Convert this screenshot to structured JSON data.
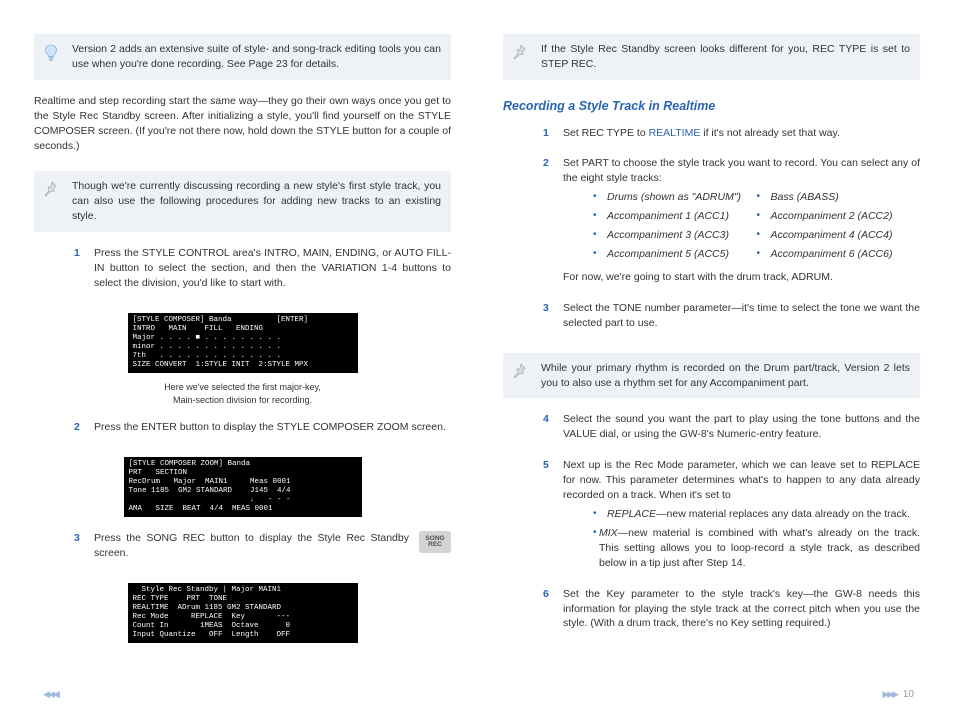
{
  "left": {
    "tip1": "Version 2 adds an extensive suite of style- and song-track editing tools you can use when you're done recording. See Page 23 for details.",
    "intro": "Realtime and step recording start the same way—they go their own ways once you get to the Style Rec Standby screen. After initializing a style, you'll find yourself on the STYLE COMPOSER screen. (If you're not there now, hold down the STYLE button for a couple of seconds.)",
    "tip2": "Though we're currently discussing recording a new style's first style track, you can also use the following procedures for adding new tracks to an existing style.",
    "step1": "Press the STYLE CONTROL area's INTRO, MAIN, ENDING, or AUTO FILL-IN button to select the section, and then the VARIATION 1-4 buttons to select the division, you'd like to start with.",
    "lcd1": "[STYLE COMPOSER] Banda          [ENTER]\nINTRO   MAIN    FILL   ENDING\nMajor . . . . ■ . . . . . . . . .\nminor . . . . . . . . . . . . . .\n7th   . . . . . . . . . . . . . .\nSIZE CONVERT  1:STYLE INIT  2:STYLE MPX",
    "caption1a": "Here we've selected the first major-key,",
    "caption1b": "Main-section division for recording.",
    "step2": "Press the ENTER button to display the STYLE COMPOSER ZOOM screen.",
    "lcd2": "[STYLE COMPOSER ZOOM] Banda\nPRT   SECTION\nRecDrum   Major  MAIN1     Meas 0001\nTone 1185  GM2 STANDARD    J145  4/4\n                           ♩   - - -\nAMA   SIZE  BEAT  4/4  MEAS 0001",
    "step3": "Press the SONG REC button to display the Style Rec Standby screen.",
    "songrec": "SONG\nREC",
    "lcd3": "  Style Rec Standby | Major MAIN1\nREC TYPE    PRT  TONE\nREALTIME  ADrum 1185 GM2 STANDARD\nRec Mode     REPLACE  Key       ---\nCount In       1MEAS  Octave      0\nInput Quantize   OFF  Length    OFF"
  },
  "right": {
    "tip1": "If the Style Rec Standby screen looks different for you, REC TYPE is set to STEP REC.",
    "heading": "Recording a Style Track in Realtime",
    "step1a": "Set REC TYPE to ",
    "step1link": "REALTIME",
    "step1b": " if it's not already set that way.",
    "step2": "Set PART to choose the style track you want to record. You can select any of the eight style tracks:",
    "bcolA": [
      "Drums (shown as \"ADRUM\")",
      "Accompaniment 1 (ACC1)",
      "Accompaniment 3 (ACC3)",
      "Accompaniment 5 (ACC5)"
    ],
    "bcolB": [
      "Bass (ABASS)",
      "Accompaniment 2 (ACC2)",
      "Accompaniment 4 (ACC4)",
      "Accompaniment 6 (ACC6)"
    ],
    "step2after": "For now, we're going to start with the drum track, ADRUM.",
    "step3": "Select the TONE number parameter—it's time to select the tone we want the selected part to use.",
    "tip2": "While your primary rhythm is recorded on the Drum part/track, Version 2 lets you to also use a rhythm set for any Accompaniment part.",
    "step4": "Select the sound you want the part to play using the tone buttons and the VALUE dial, or using the GW-8's Numeric-entry feature.",
    "step5": "Next up is the Rec Mode parameter, which we can leave set to REPLACE for now. This parameter determines what's to happen to any data already recorded on a track. When it's set to",
    "sub5": [
      {
        "term": "REPLACE",
        "rest": "—new material replaces any data already on the track."
      },
      {
        "term": "MIX",
        "rest": "—new material is combined with what's already on the track. This setting allows you to loop-record a style track, as described below in a tip just after Step 14."
      }
    ],
    "step6": "Set the Key parameter to the style track's key—the GW-8 needs this information for playing the style track at the correct pitch when you use the style. (With a drum track, there's no Key setting required.)"
  },
  "page": "10"
}
